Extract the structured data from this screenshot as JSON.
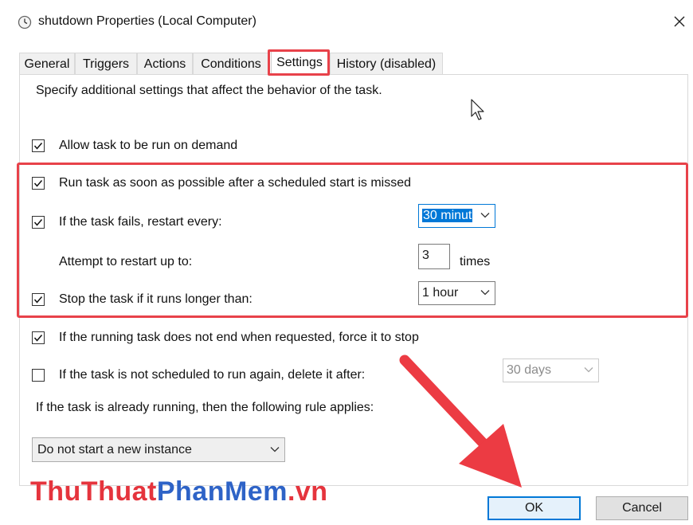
{
  "window": {
    "title": "shutdown Properties (Local Computer)",
    "icon": "clock-icon"
  },
  "tabs": [
    {
      "label": "General"
    },
    {
      "label": "Triggers"
    },
    {
      "label": "Actions"
    },
    {
      "label": "Conditions"
    },
    {
      "label": "Settings",
      "active": true
    },
    {
      "label": "History (disabled)"
    }
  ],
  "settings": {
    "description": "Specify additional settings that affect the behavior of the task.",
    "allow_demand": {
      "label": "Allow task to be run on demand",
      "checked": true
    },
    "run_missed": {
      "label": "Run task as soon as possible after a scheduled start is missed",
      "checked": true
    },
    "restart_every": {
      "label": "If the task fails, restart every:",
      "checked": true,
      "value": "30 minut"
    },
    "restart_attempts": {
      "label": "Attempt to restart up to:",
      "value": "3",
      "unit": "times"
    },
    "stop_longer": {
      "label": "Stop the task if it runs longer than:",
      "checked": true,
      "value": "1 hour"
    },
    "force_stop": {
      "label": "If the running task does not end when requested, force it to stop",
      "checked": true
    },
    "delete_after": {
      "label": "If the task is not scheduled to run again, delete it after:",
      "checked": false,
      "value": "30 days"
    },
    "rule_label": "If the task is already running, then the following rule applies:",
    "rule_value": "Do not start a new instance"
  },
  "buttons": {
    "ok": "OK",
    "cancel": "Cancel"
  },
  "watermark": {
    "part1": "ThuThuat",
    "part2": "PhanMem",
    "part3": ".vn"
  },
  "colors": {
    "highlight": "#e8424a",
    "accent": "#0078d7",
    "watermark_red": "#e5343d",
    "watermark_blue": "#2e63c7"
  }
}
